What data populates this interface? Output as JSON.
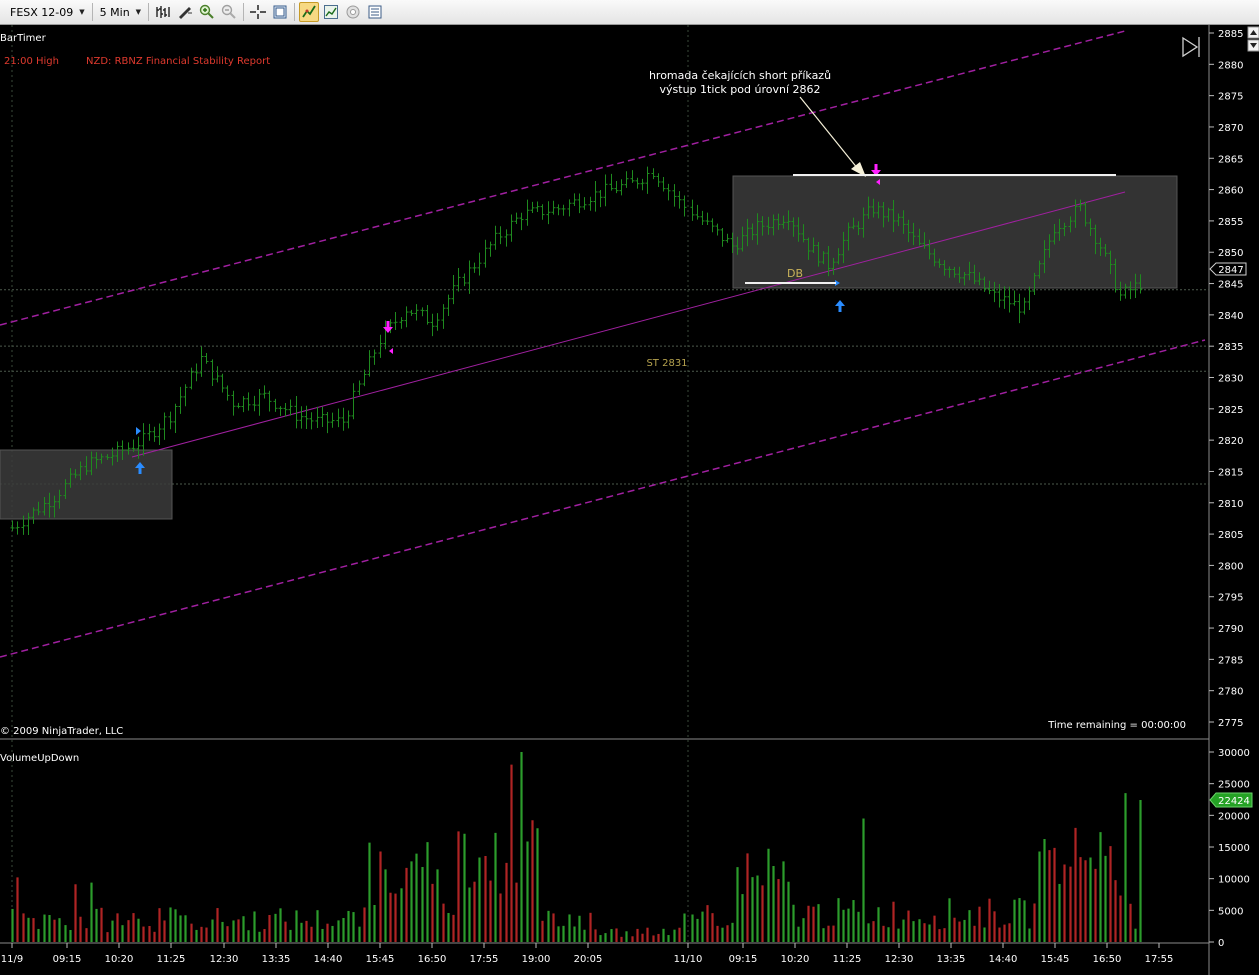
{
  "toolbar": {
    "instrument": "FESX 12-09",
    "interval": "5 Min",
    "icons": [
      "bar-type-icon",
      "draw-tool-icon",
      "zoom-in-icon",
      "zoom-out-icon",
      "crosshair-icon",
      "data-box-icon",
      "indicators-icon",
      "strategies-icon",
      "properties-icon",
      "export-icon"
    ]
  },
  "chart": {
    "indicator_label": "BarTimer",
    "event_time": "21:00 High",
    "event_text": "NZD: RBNZ Financial Stability Report",
    "annotation_line1": "hromada čekajících short příkazů",
    "annotation_line2": "výstup 1tick pod úrovní 2862",
    "db_label": "DB",
    "st_label": "ST 2831",
    "copyright": "© 2009 NinjaTrader, LLC",
    "time_remaining": "Time remaining = 00:00:00",
    "current_price": "2847",
    "volume_label": "VolumeUpDown",
    "current_volume": "22424",
    "colors": {
      "up_bar": "#1f8a1f",
      "down_bar": "#a02020",
      "channel": "#a020a0",
      "marker_magenta": "#ff20ff",
      "marker_blue": "#2a8cff"
    }
  },
  "chart_data": {
    "type": "bar",
    "title": "FESX 12-09 5 Min",
    "price_axis": {
      "ylim": [
        2772,
        2886
      ],
      "ticks": [
        2885,
        2880,
        2875,
        2870,
        2865,
        2860,
        2855,
        2850,
        2845,
        2840,
        2835,
        2830,
        2825,
        2820,
        2815,
        2810,
        2805,
        2800,
        2795,
        2790,
        2785,
        2780,
        2775
      ]
    },
    "volume_axis": {
      "ylim": [
        0,
        31000
      ],
      "ticks": [
        30000,
        25000,
        20000,
        15000,
        10000,
        5000,
        0
      ]
    },
    "x_ticks": [
      "11/9",
      "09:15",
      "10:20",
      "11:25",
      "12:30",
      "13:35",
      "14:40",
      "15:45",
      "16:50",
      "17:55",
      "19:00",
      "20:05",
      "11/10",
      "09:15",
      "10:20",
      "11:25",
      "12:30",
      "13:35",
      "14:40",
      "15:45",
      "16:50",
      "17:55"
    ],
    "price_path": [
      [
        0,
        2806
      ],
      [
        8,
        2811
      ],
      [
        14,
        2816
      ],
      [
        20,
        2818
      ],
      [
        25,
        2820
      ],
      [
        30,
        2824
      ],
      [
        36,
        2833
      ],
      [
        42,
        2826
      ],
      [
        48,
        2827
      ],
      [
        54,
        2824
      ],
      [
        58,
        2823
      ],
      [
        63,
        2823
      ],
      [
        70,
        2836
      ],
      [
        75,
        2841
      ],
      [
        80,
        2839
      ],
      [
        85,
        2845
      ],
      [
        92,
        2852
      ],
      [
        97,
        2856
      ],
      [
        104,
        2857
      ],
      [
        110,
        2859
      ],
      [
        118,
        2861
      ],
      [
        122,
        2863
      ],
      [
        127,
        2858
      ],
      [
        131,
        2855
      ],
      [
        137,
        2851
      ],
      [
        142,
        2854
      ],
      [
        148,
        2856
      ],
      [
        152,
        2851
      ],
      [
        156,
        2848
      ],
      [
        160,
        2853
      ],
      [
        165,
        2857
      ],
      [
        170,
        2855
      ],
      [
        174,
        2851
      ],
      [
        179,
        2848
      ],
      [
        184,
        2846
      ],
      [
        189,
        2843
      ],
      [
        195,
        2841
      ],
      [
        201,
        2854
      ],
      [
        206,
        2857
      ],
      [
        210,
        2851
      ],
      [
        214,
        2843
      ],
      [
        218,
        2845
      ]
    ],
    "volume": {
      "sessions": 2,
      "peak": 30000,
      "last_bar": 22424
    },
    "levels": [
      {
        "label": "ST 2831",
        "price": 2831
      },
      {
        "label": "",
        "price": 2862
      },
      {
        "label": "DB",
        "price": 2845
      }
    ]
  }
}
